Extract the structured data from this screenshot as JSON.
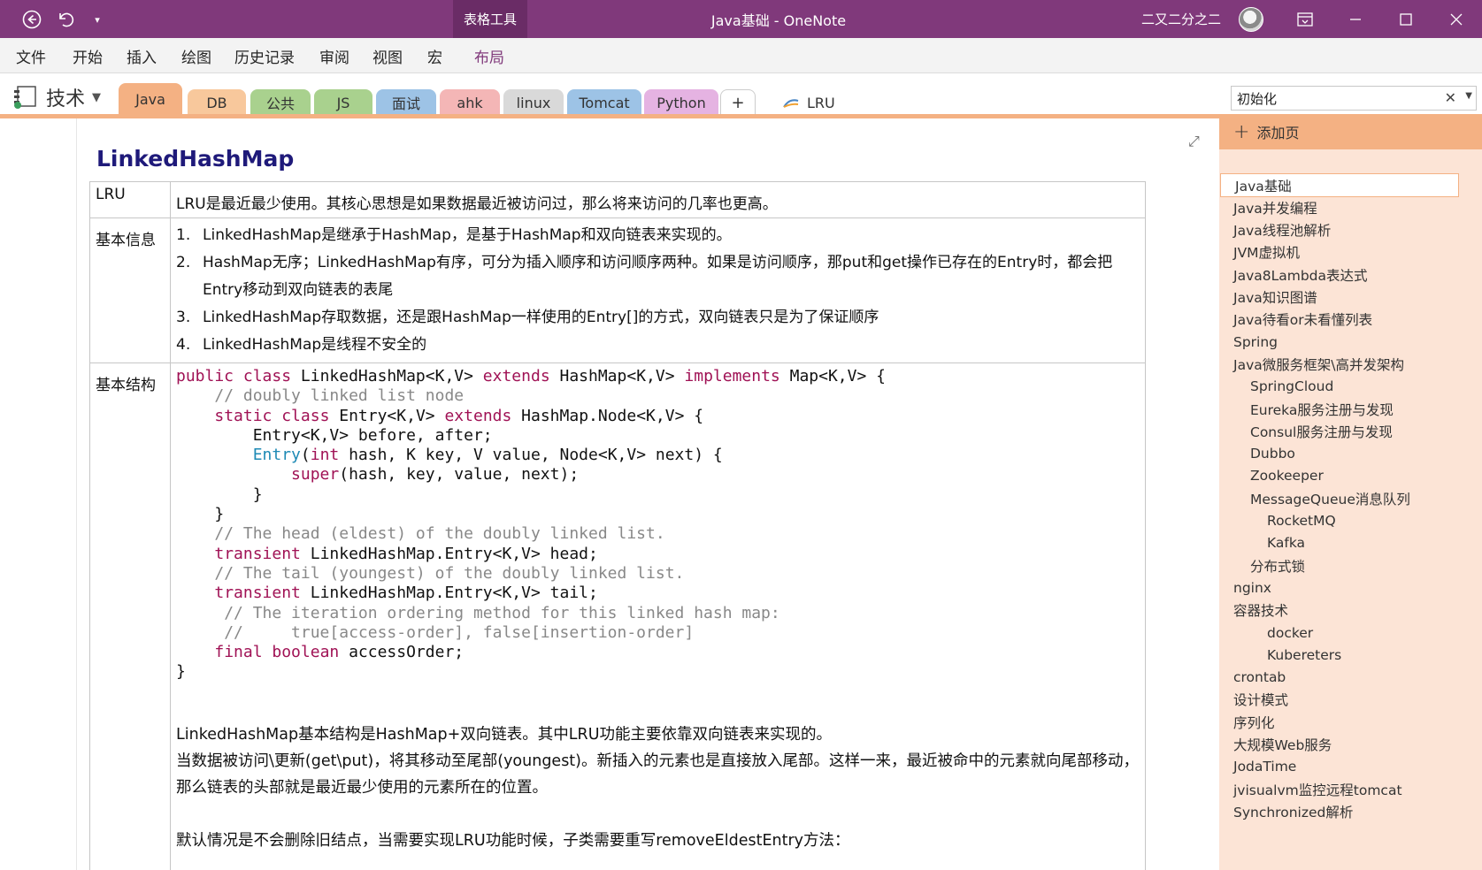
{
  "titlebar": {
    "context_tab": "表格工具",
    "title": "Java基础 - OneNote",
    "user": "二又二分之二"
  },
  "menu": [
    "文件",
    "开始",
    "插入",
    "绘图",
    "历史记录",
    "审阅",
    "视图",
    "宏",
    "布局"
  ],
  "notebook": {
    "name": "技术"
  },
  "sections": [
    {
      "label": "Java",
      "color": "#f4b183"
    },
    {
      "label": "DB",
      "color": "#f8c89c"
    },
    {
      "label": "公共",
      "color": "#a9d18e"
    },
    {
      "label": "JS",
      "color": "#a9d18e"
    },
    {
      "label": "面试",
      "color": "#9dc3e6"
    },
    {
      "label": "ahk",
      "color": "#f4b6b6"
    },
    {
      "label": "linux",
      "color": "#d9d9d9"
    },
    {
      "label": "Tomcat",
      "color": "#9dc3e6"
    },
    {
      "label": "Python",
      "color": "#e5b3e2"
    },
    {
      "label": "+",
      "color": "#ffffff"
    }
  ],
  "page_tab": {
    "label": "LRU"
  },
  "search": {
    "value": "初始化"
  },
  "page": {
    "title": "LinkedHashMap",
    "rows": {
      "lru": {
        "label": "LRU",
        "text": "LRU是最近最少使用。其核心思想是如果数据最近被访问过，那么将来访问的几率也更高。"
      },
      "info": {
        "label": "基本信息",
        "items": [
          {
            "num": "1.",
            "text": "LinkedHashMap是继承于HashMap，是基于HashMap和双向链表来实现的。"
          },
          {
            "num": "2.",
            "text": "HashMap无序；LinkedHashMap有序，可分为插入顺序和访问顺序两种。如果是访问顺序，那put和get操作已存在的Entry时，都会把Entry移动到双向链表的表尾"
          },
          {
            "num": "3.",
            "text": "LinkedHashMap存取数据，还是跟HashMap一样使用的Entry[]的方式，双向链表只是为了保证顺序"
          },
          {
            "num": "4.",
            "text": "LinkedHashMap是线程不安全的"
          }
        ]
      },
      "struct": {
        "label": "基本结构",
        "code_lines": [
          [
            [
              "kw",
              "public class "
            ],
            [
              "",
              "LinkedHashMap<K,V> "
            ],
            [
              "kw",
              "extends "
            ],
            [
              "",
              "HashMap<K,V> "
            ],
            [
              "kw",
              "implements "
            ],
            [
              "",
              "Map<K,V> {"
            ]
          ],
          [
            [
              "",
              "    "
            ],
            [
              "cm",
              "// doubly linked list node"
            ]
          ],
          [
            [
              "",
              "    "
            ],
            [
              "kw",
              "static class "
            ],
            [
              "",
              "Entry<K,V> "
            ],
            [
              "kw",
              "extends "
            ],
            [
              "",
              "HashMap.Node<K,V> {"
            ]
          ],
          [
            [
              "",
              "        Entry<K,V> before, after;"
            ]
          ],
          [
            [
              "",
              "        "
            ],
            [
              "ty",
              "Entry"
            ],
            [
              "",
              "("
            ],
            [
              "kw",
              "int "
            ],
            [
              "",
              "hash, K key, V value, Node<K,V> next) {"
            ]
          ],
          [
            [
              "",
              "            "
            ],
            [
              "kw",
              "super"
            ],
            [
              "",
              "(hash, key, value, next);"
            ]
          ],
          [
            [
              "",
              "        }"
            ]
          ],
          [
            [
              "",
              "    }"
            ]
          ],
          [
            [
              "",
              "    "
            ],
            [
              "cm",
              "// The head (eldest) of the doubly linked list."
            ]
          ],
          [
            [
              "",
              "    "
            ],
            [
              "kw",
              "transient "
            ],
            [
              "",
              "LinkedHashMap.Entry<K,V> head;"
            ]
          ],
          [
            [
              "",
              "    "
            ],
            [
              "cm",
              "// The tail (youngest) of the doubly linked list."
            ]
          ],
          [
            [
              "",
              "    "
            ],
            [
              "kw",
              "transient "
            ],
            [
              "",
              "LinkedHashMap.Entry<K,V> tail;"
            ]
          ],
          [
            [
              "",
              "     "
            ],
            [
              "cm",
              "// The iteration ordering method for this linked hash map:"
            ]
          ],
          [
            [
              "",
              "     "
            ],
            [
              "cm",
              "//     true[access-order], false[insertion-order]"
            ]
          ],
          [
            [
              "",
              "    "
            ],
            [
              "kw",
              "final boolean "
            ],
            [
              "",
              "accessOrder;"
            ]
          ],
          [
            [
              "",
              "}"
            ]
          ]
        ],
        "para1": "LinkedHashMap基本结构是HashMap+双向链表。其中LRU功能主要依靠双向链表来实现的。",
        "para2": "当数据被访问\\更新(get\\put)，将其移动至尾部(youngest)。新插入的元素也是直接放入尾部。这样一来，最近被命中的元素就向尾部移动，那么链表的头部就是最近最少使用的元素所在的位置。",
        "para3": "默认情况是不会删除旧结点，当需要实现LRU功能时候，子类需要重写removeEldestEntry方法："
      }
    }
  },
  "pagepane": {
    "add_page": "添加页",
    "pages": [
      {
        "label": "Java基础",
        "level": 0,
        "selected": true
      },
      {
        "label": "Java并发编程",
        "level": 0
      },
      {
        "label": "Java线程池解析",
        "level": 0
      },
      {
        "label": "JVM虚拟机",
        "level": 0
      },
      {
        "label": "Java8Lambda表达式",
        "level": 0
      },
      {
        "label": "Java知识图谱",
        "level": 0
      },
      {
        "label": "Java待看or未看懂列表",
        "level": 0
      },
      {
        "label": "Spring",
        "level": 0
      },
      {
        "label": "Java微服务框架\\高并发架构",
        "level": 0
      },
      {
        "label": "SpringCloud",
        "level": 1
      },
      {
        "label": "Eureka服务注册与发现",
        "level": 1
      },
      {
        "label": "Consul服务注册与发现",
        "level": 1
      },
      {
        "label": "Dubbo",
        "level": 1
      },
      {
        "label": "Zookeeper",
        "level": 1
      },
      {
        "label": "MessageQueue消息队列",
        "level": 1
      },
      {
        "label": "RocketMQ",
        "level": 2
      },
      {
        "label": "Kafka",
        "level": 2
      },
      {
        "label": "分布式锁",
        "level": 1
      },
      {
        "label": "nginx",
        "level": 0
      },
      {
        "label": "容器技术",
        "level": 0
      },
      {
        "label": "docker",
        "level": 2
      },
      {
        "label": "Kubereters",
        "level": 2
      },
      {
        "label": "crontab",
        "level": 0
      },
      {
        "label": "设计模式",
        "level": 0
      },
      {
        "label": "序列化",
        "level": 0
      },
      {
        "label": "大规模Web服务",
        "level": 0
      },
      {
        "label": "JodaTime",
        "level": 0
      },
      {
        "label": "jvisualvm监控远程tomcat",
        "level": 0
      },
      {
        "label": "Synchronized解析",
        "level": 0
      }
    ]
  }
}
